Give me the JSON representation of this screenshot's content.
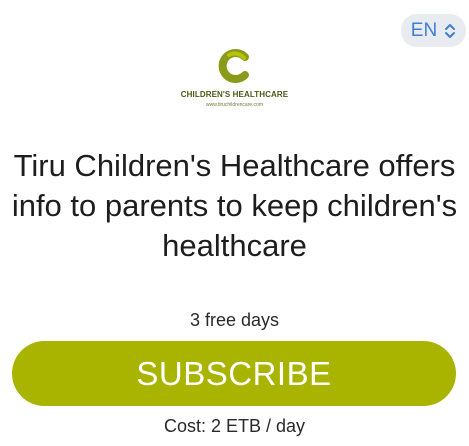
{
  "language": {
    "selected": "EN"
  },
  "brand": {
    "name": "CHILDREN'S HEALTHCARE",
    "url": "www.tiruchildrencare.com",
    "color": "#a8b400",
    "dark_color": "#4a5a1a"
  },
  "headline": "Tiru Children's Healthcare offers info to parents to keep children's healthcare",
  "offer": {
    "trial": "3 free days",
    "subscribe_label": "SUBSCRIBE",
    "cost": "Cost: 2 ETB / day"
  },
  "icons": {
    "language_toggle": "chevron-up-down-icon"
  }
}
